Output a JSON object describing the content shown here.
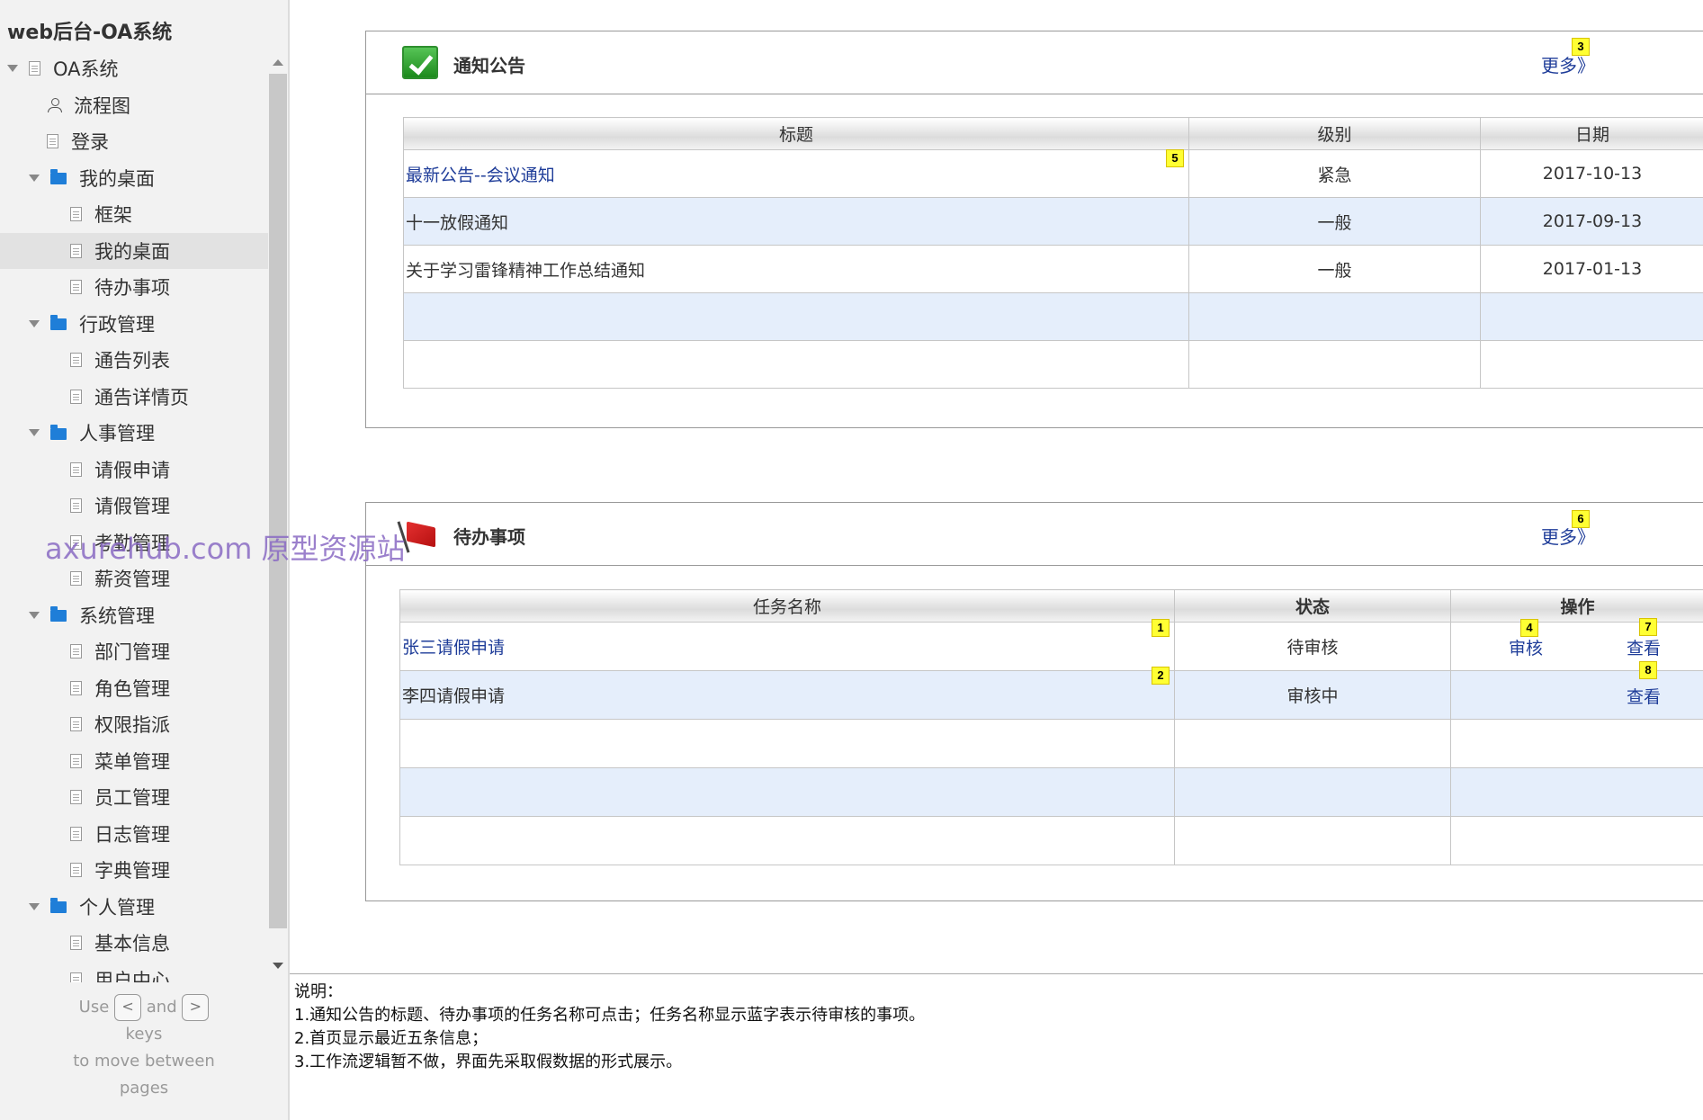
{
  "project_title": "web后台-OA系统",
  "sidebar": {
    "items": [
      {
        "label": "OA系统",
        "icon": "page-icon",
        "expander": true,
        "level": 0
      },
      {
        "label": "流程图",
        "icon": "flow-icon",
        "expander": false,
        "level": 1
      },
      {
        "label": "登录",
        "icon": "page-icon",
        "expander": false,
        "level": 1
      },
      {
        "label": "我的桌面",
        "icon": "folder-icon",
        "expander": true,
        "level": 1
      },
      {
        "label": "框架",
        "icon": "page-icon",
        "expander": false,
        "level": 2
      },
      {
        "label": "我的桌面",
        "icon": "page-icon",
        "expander": false,
        "level": 2,
        "selected": true
      },
      {
        "label": "待办事项",
        "icon": "page-icon",
        "expander": false,
        "level": 2
      },
      {
        "label": "行政管理",
        "icon": "folder-icon",
        "expander": true,
        "level": 1
      },
      {
        "label": "通告列表",
        "icon": "page-icon",
        "expander": false,
        "level": 2
      },
      {
        "label": "通告详情页",
        "icon": "page-icon",
        "expander": false,
        "level": 2
      },
      {
        "label": "人事管理",
        "icon": "folder-icon",
        "expander": true,
        "level": 1
      },
      {
        "label": "请假申请",
        "icon": "page-icon",
        "expander": false,
        "level": 2
      },
      {
        "label": "请假管理",
        "icon": "page-icon",
        "expander": false,
        "level": 2
      },
      {
        "label": "考勤管理",
        "icon": "page-icon",
        "expander": false,
        "level": 2
      },
      {
        "label": "薪资管理",
        "icon": "page-icon",
        "expander": false,
        "level": 2
      },
      {
        "label": "系统管理",
        "icon": "folder-icon",
        "expander": true,
        "level": 1
      },
      {
        "label": "部门管理",
        "icon": "page-icon",
        "expander": false,
        "level": 2
      },
      {
        "label": "角色管理",
        "icon": "page-icon",
        "expander": false,
        "level": 2
      },
      {
        "label": "权限指派",
        "icon": "page-icon",
        "expander": false,
        "level": 2
      },
      {
        "label": "菜单管理",
        "icon": "page-icon",
        "expander": false,
        "level": 2
      },
      {
        "label": "员工管理",
        "icon": "page-icon",
        "expander": false,
        "level": 2
      },
      {
        "label": "日志管理",
        "icon": "page-icon",
        "expander": false,
        "level": 2
      },
      {
        "label": "字典管理",
        "icon": "page-icon",
        "expander": false,
        "level": 2
      },
      {
        "label": "个人管理",
        "icon": "folder-icon",
        "expander": true,
        "level": 1
      },
      {
        "label": "基本信息",
        "icon": "page-icon",
        "expander": false,
        "level": 2
      },
      {
        "label": "用户中心",
        "icon": "page-icon",
        "expander": false,
        "level": 2
      }
    ],
    "hint": {
      "use": "Use",
      "key_prev": "<",
      "and": "and",
      "key_next": ">",
      "keys": "keys",
      "move": "to move between",
      "pages": "pages"
    }
  },
  "watermark": "axurehub.com 原型资源站",
  "notice_panel": {
    "title": "通知公告",
    "more": "更多》",
    "columns": [
      "标题",
      "级别",
      "日期"
    ],
    "rows": [
      {
        "title": "最新公告--会议通知",
        "level": "紧急",
        "date": "2017-10-13",
        "link": true
      },
      {
        "title": "十一放假通知",
        "level": "一般",
        "date": "2017-09-13",
        "link": false
      },
      {
        "title": "关于学习雷锋精神工作总结通知",
        "level": "一般",
        "date": "2017-01-13",
        "link": false
      },
      {
        "title": "",
        "level": "",
        "date": "",
        "link": false
      },
      {
        "title": "",
        "level": "",
        "date": "",
        "link": false
      }
    ]
  },
  "todo_panel": {
    "title": "待办事项",
    "more": "更多》",
    "columns": [
      "任务名称",
      "状态",
      "操作"
    ],
    "rows": [
      {
        "name": "张三请假申请",
        "status": "待审核",
        "op_review": "审核",
        "op_view": "查看",
        "link": true
      },
      {
        "name": "李四请假申请",
        "status": "审核中",
        "op_review": "",
        "op_view": "查看",
        "link": false
      },
      {
        "name": "",
        "status": "",
        "op_review": "",
        "op_view": "",
        "link": false
      },
      {
        "name": "",
        "status": "",
        "op_review": "",
        "op_view": "",
        "link": false
      },
      {
        "name": "",
        "status": "",
        "op_review": "",
        "op_view": "",
        "link": false
      }
    ]
  },
  "markers": [
    "1",
    "2",
    "3",
    "4",
    "5",
    "6",
    "7",
    "8"
  ],
  "notes": {
    "heading": "说明：",
    "lines": [
      "1.通知公告的标题、待办事项的任务名称可点击；任务名称显示蓝字表示待审核的事项。",
      "2.首页显示最近五条信息；",
      "3.工作流逻辑暂不做，界面先采取假数据的形式展示。"
    ]
  },
  "colors": {
    "link": "#1f3d99",
    "row_alt": "#e5eefb",
    "marker": "#ffff33",
    "folder": "#1f7ed8"
  }
}
